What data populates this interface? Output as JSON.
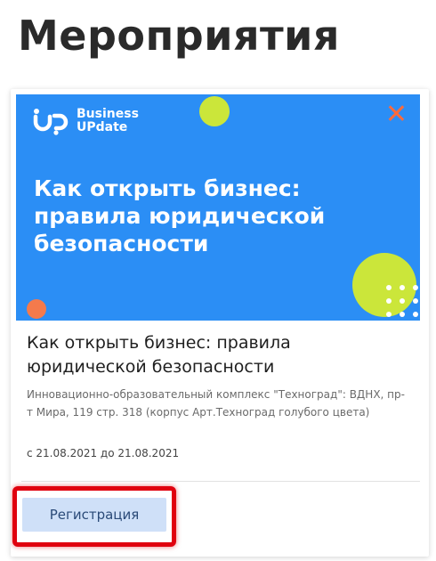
{
  "page": {
    "title": "Мероприятия"
  },
  "event": {
    "banner": {
      "brand_line1": "Business",
      "brand_line2": "UPdate",
      "heading": "Как открыть бизнес: правила юридической безопасности",
      "close_glyph": "✕"
    },
    "title": "Как открыть бизнес: правила юридической безопасности",
    "location": "Инновационно-образовательный комплекс \"Техноград\": ВДНХ, пр-т Мира, 119 стр. 318 (корпус Арт.Техноград голубого цвета)",
    "dates": "с 21.08.2021 до 21.08.2021",
    "register_label": "Регистрация"
  },
  "colors": {
    "banner_blue": "#2b8ef5",
    "accent_lime": "#cbe63a",
    "accent_orange": "#f47a4c",
    "highlight_red": "#e0000e",
    "button_bg": "#cfe0f8"
  },
  "icons": {
    "logo": "up-logo-icon",
    "close": "close-icon"
  }
}
